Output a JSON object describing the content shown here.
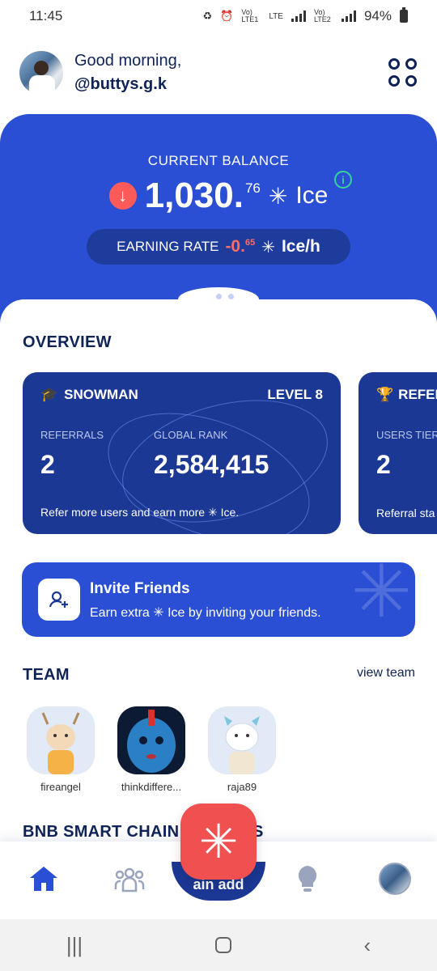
{
  "status_bar": {
    "time": "11:45",
    "icons": [
      "sync-icon",
      "alarm-icon"
    ],
    "net1": "Vo) LTE1",
    "net_lte": "LTE",
    "net2": "Vo) LTE2",
    "battery": "94%"
  },
  "header": {
    "greeting": "Good morning,",
    "username": "@buttys.g.k"
  },
  "balance": {
    "label": "CURRENT BALANCE",
    "integer": "1,030.",
    "decimal": "76",
    "unit": "Ice",
    "rate_label": "EARNING RATE",
    "rate_value": "-0.",
    "rate_decimal": "65",
    "rate_unit": "Ice/h"
  },
  "overview": {
    "title": "OVERVIEW",
    "card1": {
      "name": "SNOWMAN",
      "level": "LEVEL 8",
      "referrals_label": "REFERRALS",
      "referrals_value": "2",
      "rank_label": "GLOBAL RANK",
      "rank_value": "2,584,415",
      "footer": "Refer more users and earn more ✳ Ice."
    },
    "card2": {
      "name": "REFER",
      "tier_label": "USERS TIER",
      "tier_value": "2",
      "footer": "Referral sta"
    }
  },
  "invite": {
    "title": "Invite Friends",
    "subtitle": "Earn extra ✳ Ice by inviting your friends."
  },
  "team": {
    "title": "TEAM",
    "view_link": "view team",
    "members": [
      {
        "name": "fireangel"
      },
      {
        "name": "thinkdiffere..."
      },
      {
        "name": "raja89"
      }
    ]
  },
  "chain": {
    "title": "BNB SMART CHAIN ADDRESS",
    "partial_title_left": "BNB SMART CHAIN",
    "partial_title_right": "S",
    "fab_caption": "ain add"
  },
  "colors": {
    "primary": "#2a4fd4",
    "dark_navy": "#0f2356",
    "card": "#1c3895",
    "negative": "#ff5a5a",
    "fab": "#f05050",
    "info": "#34d399"
  }
}
